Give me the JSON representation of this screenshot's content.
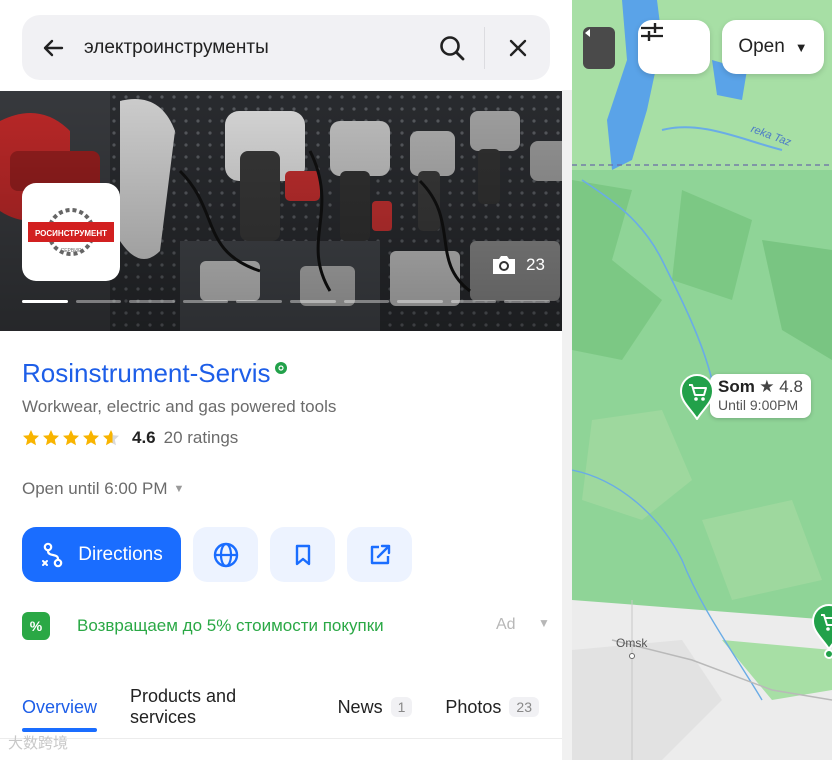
{
  "search": {
    "query": "электроинструменты"
  },
  "gallery": {
    "photo_count": "23",
    "logo_text": "РОСИНСТРУМЕНТ",
    "logo_subtext": "СЕРВИС"
  },
  "business": {
    "name": "Rosinstrument-Servis",
    "category": "Workwear, electric and gas powered tools",
    "rating": "4.6",
    "rating_value": 4.6,
    "ratings_count": "20 ratings",
    "hours": "Open until 6:00 PM"
  },
  "actions": {
    "directions_label": "Directions"
  },
  "ad": {
    "badge": "%",
    "text": "Возвращаем до 5% стоимости покупки",
    "label": "Ad"
  },
  "tabs": [
    {
      "label": "Overview",
      "count": ""
    },
    {
      "label": "Products and services",
      "count": ""
    },
    {
      "label": "News",
      "count": "1"
    },
    {
      "label": "Photos",
      "count": "23"
    }
  ],
  "watermark": "大数跨境",
  "map": {
    "open_filter_label": "Open",
    "pins": [
      {
        "name": "Som",
        "rating": "★ 4.8",
        "hours": "Until 9:00PM"
      }
    ],
    "city_label": "Omsk",
    "river_label": "reka Taz"
  },
  "colors": {
    "accent": "#1a6dff",
    "link": "#1d5ee8",
    "ad_green": "#2aa845",
    "star": "#f8b400",
    "map_land": "#8fd497",
    "map_water": "#5aa3e8"
  }
}
